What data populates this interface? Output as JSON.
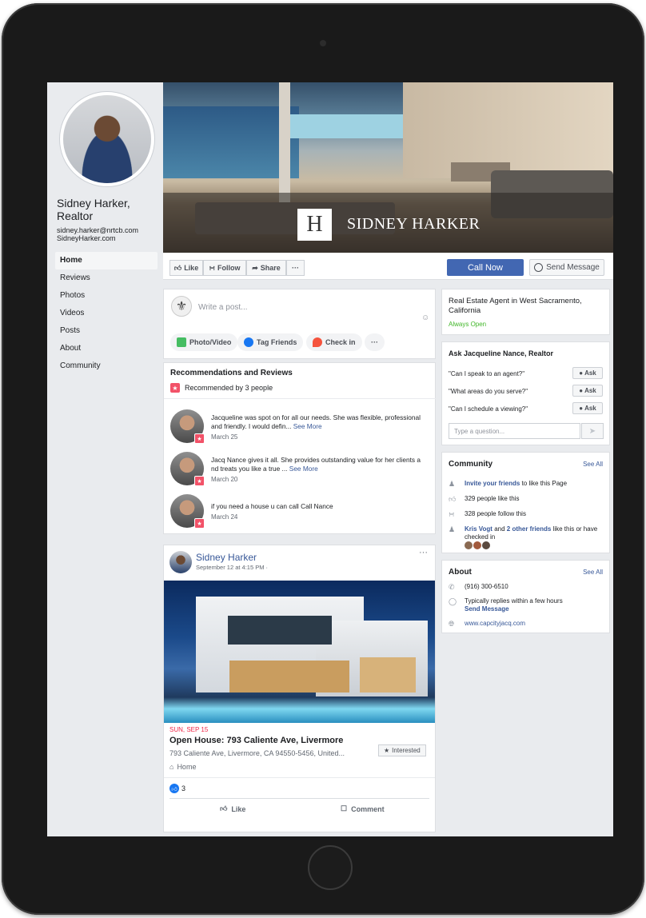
{
  "profile": {
    "name": "Sidney Harker, Realtor",
    "email": "sidney.harker@nrtcb.com",
    "website_short": "SidneyHarker.com"
  },
  "nav": {
    "items": [
      "Home",
      "Reviews",
      "Photos",
      "Videos",
      "Posts",
      "About",
      "Community"
    ],
    "active": "Home"
  },
  "cover": {
    "logo_letter": "H",
    "title": "SIDNEY HARKER"
  },
  "actions": {
    "like": "Like",
    "follow": "Follow",
    "share": "Share",
    "more": "···",
    "call_now": "Call Now",
    "send_message": "Send Message"
  },
  "composer": {
    "placeholder": "Write a post...",
    "photo_video": "Photo/Video",
    "tag_friends": "Tag Friends",
    "check_in": "Check in",
    "more": "···"
  },
  "recommendations": {
    "title": "Recommendations and Reviews",
    "summary": "Recommended by 3 people",
    "reviews": [
      {
        "text": "Jacqueline was spot on for all our needs. She was flexible, professional and friendly. I would defin...",
        "more": "See More",
        "date": "March 25"
      },
      {
        "text": "Jacq Nance gives it all.  She provides outstanding value for her clients a nd treats you like a true ...",
        "more": "See More",
        "date": "March 20"
      },
      {
        "text": "if you need a house u can call Call Nance",
        "more": "",
        "date": "March 24"
      }
    ]
  },
  "post": {
    "author": "Sidney Harker",
    "date": "September 12 at 4:15 PM ·",
    "more": "···",
    "event_date": "SUN, SEP 15",
    "event_title": "Open House: 793 Caliente Ave, Livermore",
    "event_address": "793 Caliente Ave, Livermore, CA 94550-5456, United...",
    "event_category": "Home",
    "interested": "Interested",
    "likes_count": "3",
    "like_label": "Like",
    "comment_label": "Comment"
  },
  "info": {
    "category": "Real Estate Agent in West Sacramento, California",
    "hours": "Always Open"
  },
  "ask": {
    "title": "Ask Jacqueline Nance, Realtor",
    "questions": [
      "\"Can I speak to an agent?\"",
      "\"What areas do you serve?\"",
      "\"Can I schedule a viewing?\""
    ],
    "ask_label": "Ask",
    "placeholder": "Type a question..."
  },
  "community": {
    "title": "Community",
    "see_all": "See All",
    "invite_link": "Invite your friends",
    "invite_rest": " to like this Page",
    "likes": "329 people like this",
    "follows": "328 people follow this",
    "friend_name": "Kris Vogt",
    "friend_and": " and ",
    "friend_others": "2 other friends",
    "friend_rest": " like this or have checked in"
  },
  "about": {
    "title": "About",
    "see_all": "See All",
    "phone": "(916) 300-6510",
    "reply_time": "Typically replies within a few hours",
    "send_message": "Send Message",
    "website": "www.capcityjacq.com"
  },
  "colors": {
    "brand_blue": "#4267b2",
    "link_blue": "#385898",
    "open_green": "#42b72a",
    "event_red": "#f02849",
    "review_badge": "#f25268"
  }
}
